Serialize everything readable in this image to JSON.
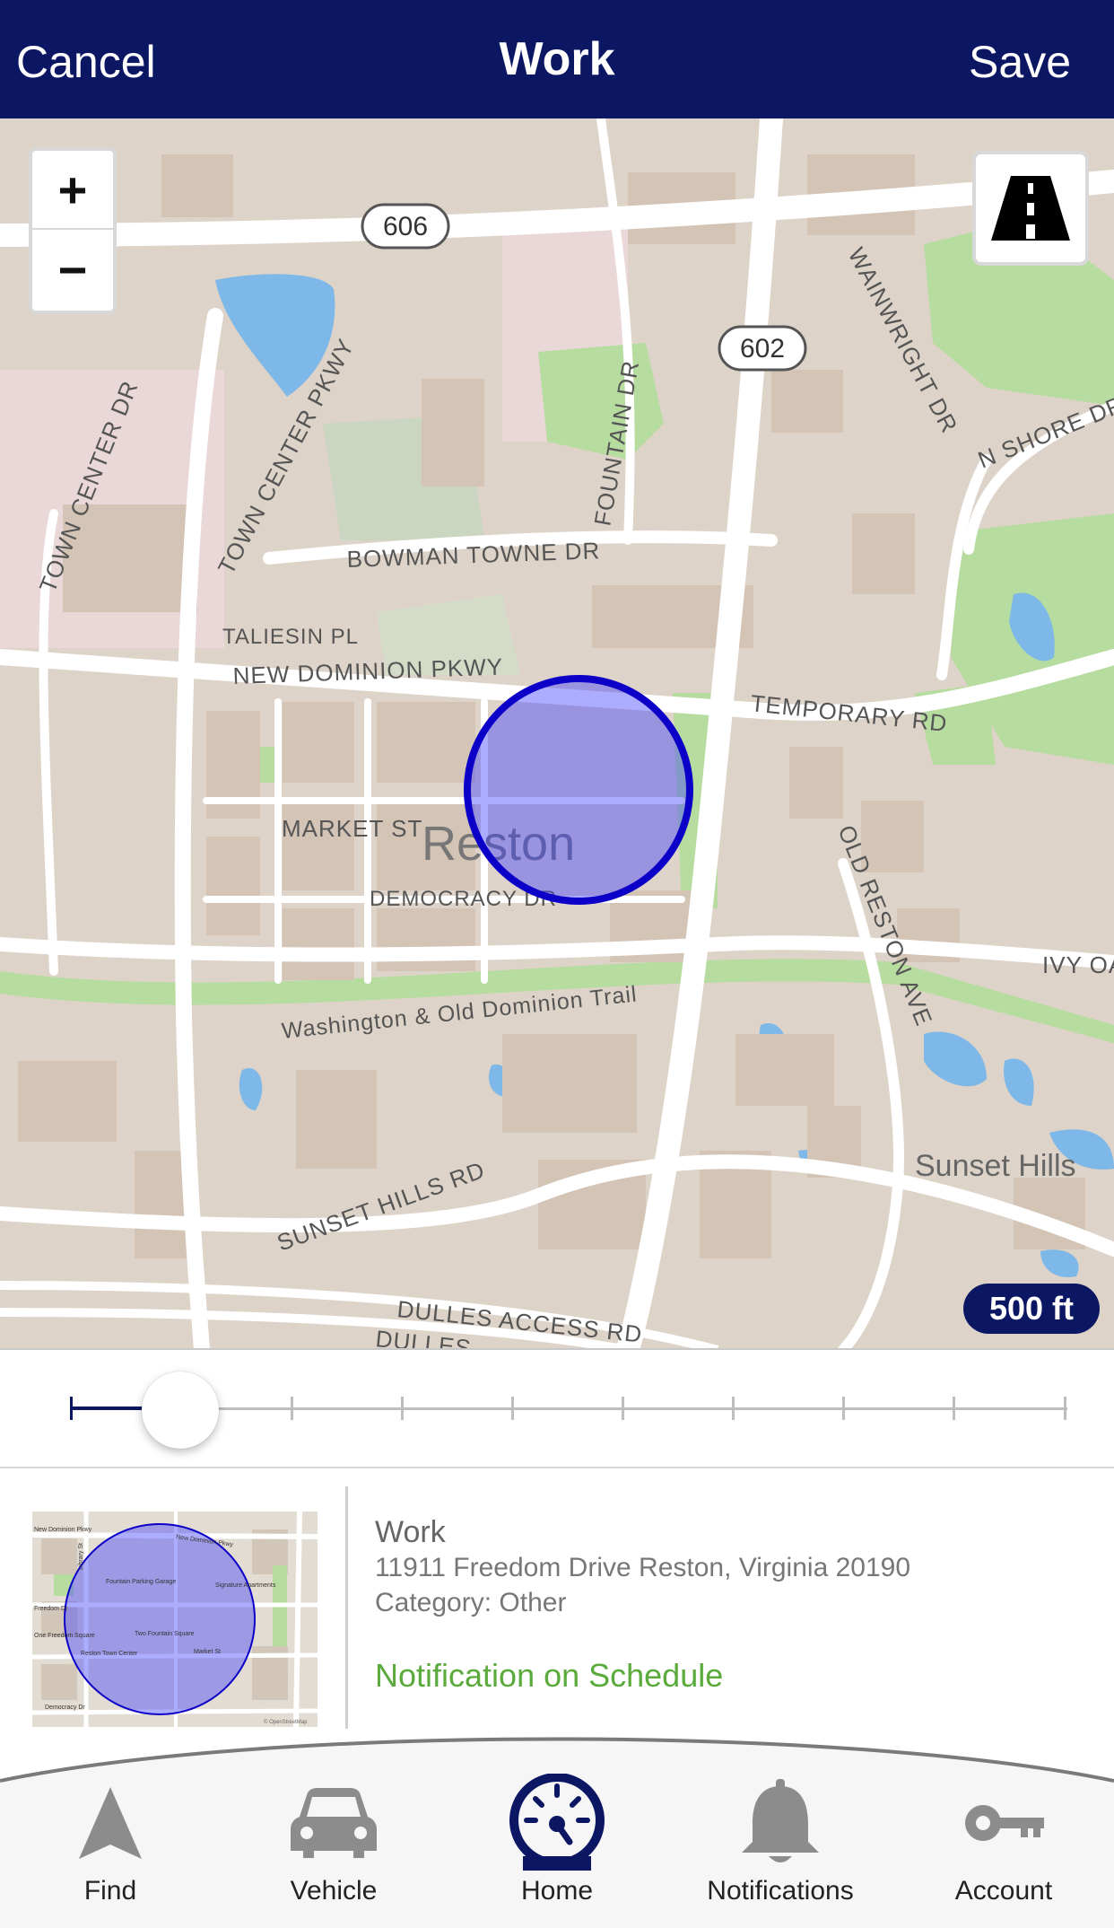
{
  "header": {
    "cancel_label": "Cancel",
    "title": "Work",
    "save_label": "Save"
  },
  "map": {
    "zoom_in_label": "+",
    "zoom_out_label": "−",
    "scale_label": "500 ft",
    "labels": {
      "route_606": "606",
      "route_602": "602",
      "town_center_dr": "TOWN CENTER DR",
      "town_center_pkwy": "TOWN CENTER PKWY",
      "fountain_dr": "FOUNTAIN DR",
      "wainwright_dr": "WAINWRIGHT DR",
      "n_shore_dr": "N SHORE DR",
      "bowman_towne_dr": "BOWMAN TOWNE DR",
      "taliesin_pl": "TALIESIN PL",
      "new_dominion_pkwy": "NEW DOMINION PKWY",
      "temporary_rd": "TEMPORARY RD",
      "market_st": "MARKET ST",
      "reston": "Reston",
      "democracy_dr": "DEMOCRACY DR",
      "old_reston_ave": "OLD RESTON AVE",
      "ivy_oak": "IVY OA",
      "wod_trail": "Washington & Old Dominion Trail",
      "sunset_hills": "Sunset Hills",
      "sunset_hills_rd": "SUNSET HILLS RD",
      "dulles_access_rd": "DULLES ACCESS RD",
      "dulles_2": "DULLES"
    },
    "geofence_color": "#0c00c8"
  },
  "slider": {
    "ticks": 10,
    "value_index": 1
  },
  "location": {
    "name": "Work",
    "address": "11911 Freedom Drive Reston, Virginia 20190",
    "category": "Category: Other",
    "notification": "Notification on Schedule",
    "thumbnail_labels": {
      "new_dominion": "New Dominion Pkwy",
      "new_dominion_2": "New Dominion Pkwy",
      "freedom_dr": "Freedom Dr",
      "library_st": "Library St",
      "market_st": "Market St",
      "democracy_dr": "Democracy Dr",
      "reston_town_center": "Reston Town Center",
      "two_fountain": "Two Fountain Square",
      "fountain_garage": "Fountain Parking Garage",
      "signature": "Signature Apartments",
      "one_freedom": "One Freedom Square",
      "attribution": "© OpenStreetMap"
    }
  },
  "tabs": [
    {
      "label": "Find",
      "icon": "navigation-arrow-icon"
    },
    {
      "label": "Vehicle",
      "icon": "car-icon"
    },
    {
      "label": "Home",
      "icon": "speedometer-icon"
    },
    {
      "label": "Notifications",
      "icon": "bell-icon"
    },
    {
      "label": "Account",
      "icon": "key-icon"
    }
  ],
  "colors": {
    "header_bg": "#0c1764",
    "accent": "#0c1764",
    "notification_green": "#5aaa3c",
    "map_bg": "#ded3c8"
  }
}
